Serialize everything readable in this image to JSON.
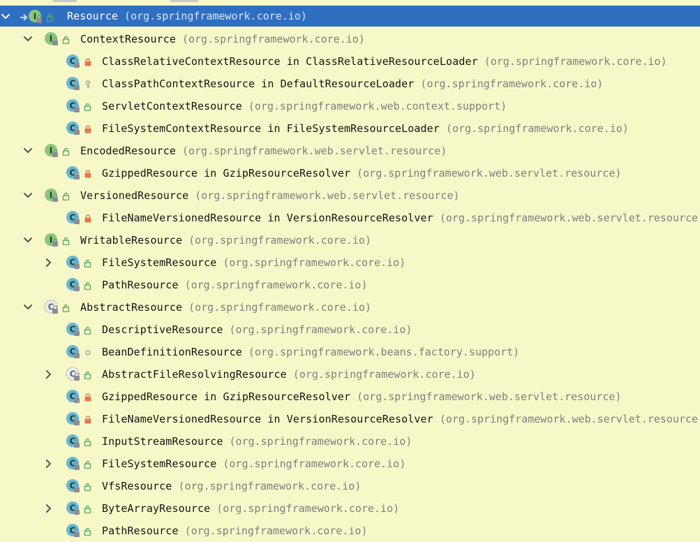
{
  "tree": {
    "rows": [
      {
        "name": "Resource",
        "package": "(org.springframework.core.io)",
        "kind": "interface",
        "visibility": "public",
        "expander": "expanded",
        "level": 0,
        "selected": true
      },
      {
        "name": "ContextResource",
        "package": "(org.springframework.core.io)",
        "kind": "interface",
        "visibility": "public",
        "expander": "expanded",
        "level": 1
      },
      {
        "name": "ClassRelativeContextResource in ClassRelativeResourceLoader",
        "package": "(org.springframework.core.io)",
        "kind": "class",
        "visibility": "private",
        "expander": "none",
        "level": 2
      },
      {
        "name": "ClassPathContextResource in DefaultResourceLoader",
        "package": "(org.springframework.core.io)",
        "kind": "class",
        "visibility": "protected",
        "expander": "none",
        "level": 2
      },
      {
        "name": "ServletContextResource",
        "package": "(org.springframework.web.context.support)",
        "kind": "class",
        "visibility": "public",
        "expander": "none",
        "level": 2
      },
      {
        "name": "FileSystemContextResource in FileSystemResourceLoader",
        "package": "(org.springframework.core.io)",
        "kind": "class",
        "visibility": "private",
        "expander": "none",
        "level": 2
      },
      {
        "name": "EncodedResource",
        "package": "(org.springframework.web.servlet.resource)",
        "kind": "interface",
        "visibility": "public",
        "expander": "expanded",
        "level": 1
      },
      {
        "name": "GzippedResource in GzipResourceResolver",
        "package": "(org.springframework.web.servlet.resource)",
        "kind": "class",
        "visibility": "private",
        "expander": "none",
        "level": 2
      },
      {
        "name": "VersionedResource",
        "package": "(org.springframework.web.servlet.resource)",
        "kind": "interface",
        "visibility": "public",
        "expander": "expanded",
        "level": 1
      },
      {
        "name": "FileNameVersionedResource in VersionResourceResolver",
        "package": "(org.springframework.web.servlet.resource)",
        "kind": "class",
        "visibility": "private",
        "expander": "none",
        "level": 2
      },
      {
        "name": "WritableResource",
        "package": "(org.springframework.core.io)",
        "kind": "interface",
        "visibility": "public",
        "expander": "expanded",
        "level": 1
      },
      {
        "name": "FileSystemResource",
        "package": "(org.springframework.core.io)",
        "kind": "class",
        "visibility": "public",
        "expander": "collapsed",
        "level": 2
      },
      {
        "name": "PathResource",
        "package": "(org.springframework.core.io)",
        "kind": "class",
        "visibility": "public",
        "expander": "none",
        "level": 2
      },
      {
        "name": "AbstractResource",
        "package": "(org.springframework.core.io)",
        "kind": "abstract-class",
        "visibility": "public",
        "expander": "expanded",
        "level": 1
      },
      {
        "name": "DescriptiveResource",
        "package": "(org.springframework.core.io)",
        "kind": "class",
        "visibility": "public",
        "expander": "none",
        "level": 2
      },
      {
        "name": "BeanDefinitionResource",
        "package": "(org.springframework.beans.factory.support)",
        "kind": "class",
        "visibility": "package",
        "expander": "none",
        "level": 2
      },
      {
        "name": "AbstractFileResolvingResource",
        "package": "(org.springframework.core.io)",
        "kind": "abstract-class",
        "visibility": "public",
        "expander": "collapsed",
        "level": 2
      },
      {
        "name": "GzippedResource in GzipResourceResolver",
        "package": "(org.springframework.web.servlet.resource)",
        "kind": "class",
        "visibility": "private",
        "expander": "none",
        "level": 2
      },
      {
        "name": "FileNameVersionedResource in VersionResourceResolver",
        "package": "(org.springframework.web.servlet.resource)",
        "kind": "class",
        "visibility": "private",
        "expander": "none",
        "level": 2
      },
      {
        "name": "InputStreamResource",
        "package": "(org.springframework.core.io)",
        "kind": "class",
        "visibility": "public",
        "expander": "none",
        "level": 2
      },
      {
        "name": "FileSystemResource",
        "package": "(org.springframework.core.io)",
        "kind": "class",
        "visibility": "public",
        "expander": "collapsed",
        "level": 2
      },
      {
        "name": "VfsResource",
        "package": "(org.springframework.core.io)",
        "kind": "class",
        "visibility": "public",
        "expander": "none",
        "level": 2
      },
      {
        "name": "ByteArrayResource",
        "package": "(org.springframework.core.io)",
        "kind": "class",
        "visibility": "public",
        "expander": "collapsed",
        "level": 2
      },
      {
        "name": "PathResource",
        "package": "(org.springframework.core.io)",
        "kind": "class",
        "visibility": "public",
        "expander": "none",
        "level": 2
      }
    ]
  },
  "colors": {
    "background": "#f7f8c8",
    "selection": "#2f6fc2",
    "interface_icon": "#88c87a",
    "class_icon": "#62b8d6",
    "public_lock": "#59a869",
    "private_lock": "#e07a4f",
    "package_text": "#7f7f7f"
  },
  "icons": {
    "interface": "interface-icon",
    "class": "class-icon",
    "abstract-class": "abstract-class-icon",
    "expanded": "chevron-down-icon",
    "collapsed": "chevron-right-icon",
    "public": "public-lock-icon",
    "private": "private-lock-icon",
    "protected": "protected-key-icon",
    "package": "package-dot-icon"
  }
}
